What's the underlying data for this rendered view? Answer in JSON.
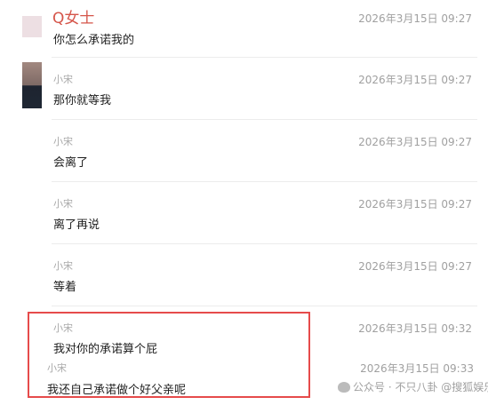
{
  "colors": {
    "highlight_border": "#e64b4b",
    "named_sender": "#d5554a"
  },
  "messages": [
    {
      "sender": "Q女士",
      "time": "2026年3月15日 09:27",
      "text": "你怎么承诺我的"
    },
    {
      "sender": "小宋",
      "time": "2026年3月15日 09:27",
      "text": "那你就等我"
    },
    {
      "sender": "小宋",
      "time": "2026年3月15日 09:27",
      "text": "会离了"
    },
    {
      "sender": "小宋",
      "time": "2026年3月15日 09:27",
      "text": "离了再说"
    },
    {
      "sender": "小宋",
      "time": "2026年3月15日 09:27",
      "text": "等着"
    },
    {
      "sender": "小宋",
      "time": "2026年3月15日 09:32",
      "text": "我对你的承诺算个屁"
    },
    {
      "sender": "小宋",
      "time": "2026年3月15日 09:33",
      "text": "我还自己承诺做个好父亲呢"
    }
  ],
  "watermark": "公众号 · 不只八卦 @搜狐娱乐"
}
